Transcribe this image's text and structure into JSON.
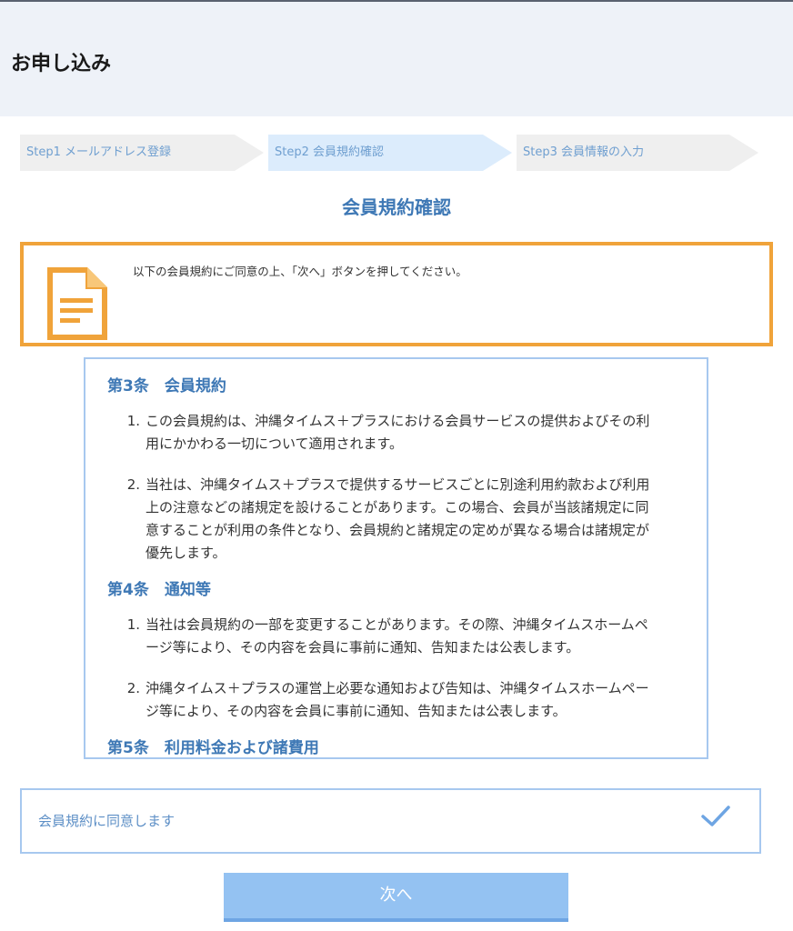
{
  "header": {
    "title": "お申し込み"
  },
  "steps": [
    {
      "label": "Step1 メールアドレス登録"
    },
    {
      "label": "Step2 会員規約確認"
    },
    {
      "label": "Step3 会員情報の入力"
    }
  ],
  "page_title": "会員規約確認",
  "notice": {
    "text": "以下の会員規約にご同意の上、「次へ」ボタンを押してください。",
    "icon": "document-icon"
  },
  "terms": {
    "articles": [
      {
        "title": "第3条　会員規約",
        "clauses": [
          {
            "num": "1.",
            "lines": [
              "この会員規約は、沖縄タイムス＋プラスにおける会員サービスの提供およびその利",
              "用にかかわる一切について適用されます。"
            ]
          },
          {
            "num": "2.",
            "lines": [
              "当社は、沖縄タイムス＋プラスで提供するサービスごとに別途利用約款および利用",
              "上の注意などの諸規定を設けることがあります。この場合、会員が当該諸規定に同",
              "意することが利用の条件となり、会員規約と諸規定の定めが異なる場合は諸規定が",
              "優先します。"
            ]
          }
        ]
      },
      {
        "title": "第4条　通知等",
        "clauses": [
          {
            "num": "1.",
            "lines": [
              "当社は会員規約の一部を変更することがあります。その際、沖縄タイムスホームペ",
              "ージ等により、その内容を会員に事前に通知、告知または公表します。"
            ]
          },
          {
            "num": "2.",
            "lines": [
              "沖縄タイムス＋プラスの運営上必要な通知および告知は、沖縄タイムスホームペー",
              "ジ等により、その内容を会員に事前に通知、告知または公表します。"
            ]
          }
        ]
      }
    ],
    "cutoff_title": "第5条　利用料金および諸費用"
  },
  "agree": {
    "label": "会員規約に同意します",
    "icon": "checkmark-icon"
  },
  "next_button": {
    "label": "次へ"
  },
  "colors": {
    "accent": "#3e78b5",
    "notice_border": "#f0a33a",
    "button": "#94c2f2"
  }
}
